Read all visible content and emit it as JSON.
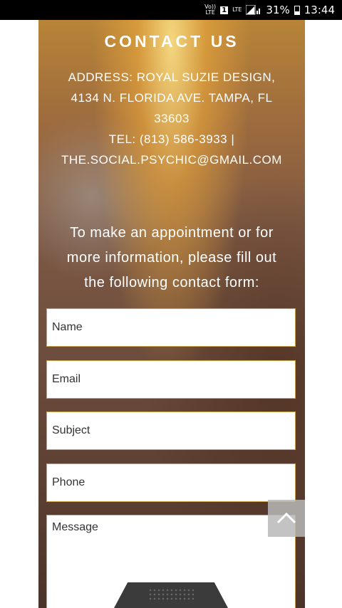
{
  "status_bar": {
    "volte_top": "Vo))",
    "volte_bottom": "LTE",
    "sim_label": "1",
    "lte_label": "LTE",
    "battery": "31%",
    "time": "13:44",
    "battery_level": 0.31
  },
  "contact": {
    "title": "CONTACT US",
    "address_line1": "ADDRESS: ROYAL SUZIE DESIGN,",
    "address_line2": "4134 N. FLORIDA AVE. TAMPA, FL",
    "address_line3": "33603",
    "tel_line": "TEL: (813) 586-3933  |",
    "email_line": "THE.SOCIAL.PSYCHIC@GMAIL.COM",
    "intro_line1": "To make an appointment or for",
    "intro_line2": "more information, please fill out",
    "intro_line3": "the following contact form:"
  },
  "form": {
    "name_placeholder": "Name",
    "email_placeholder": "Email",
    "subject_placeholder": "Subject",
    "phone_placeholder": "Phone",
    "message_placeholder": "Message"
  },
  "icons": {
    "back_to_top": "chevron-up-icon",
    "nav_handle": "navigation-handle-icon"
  },
  "colors": {
    "field_border": "#c9a24a",
    "back_to_top_bg": "#b9b9b9"
  }
}
